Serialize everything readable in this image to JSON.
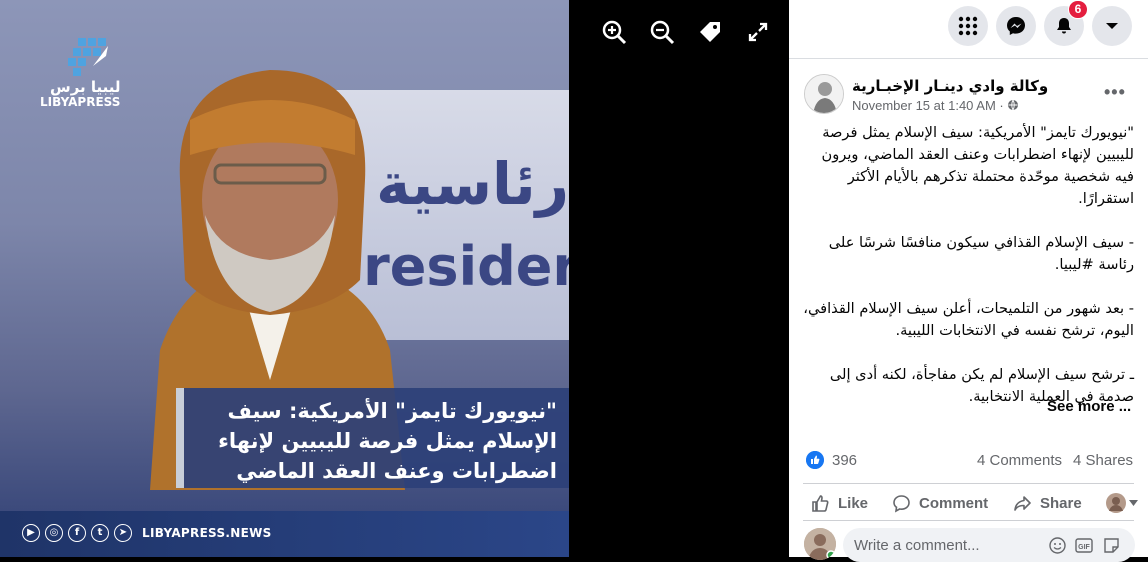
{
  "viewer": {
    "image": {
      "logo_ar": "ليبيا برس",
      "logo_en": "LIBYAPRESS",
      "banner_ar": "رئاسية",
      "banner_en": "Presider",
      "caption": "\"نيويورك تايمز\" الأمريكية: سيف الإسلام يمثل فرصة لليبيين لإنهاء اضطرابات وعنف العقد الماضي",
      "site": "LIBYAPRESS.NEWS",
      "socials": [
        "youtube-icon",
        "instagram-icon",
        "facebook-icon",
        "twitter-icon",
        "telegram-icon"
      ]
    },
    "tools": [
      "zoom-in-icon",
      "zoom-out-icon",
      "tag-icon",
      "fullscreen-icon"
    ]
  },
  "topbar": {
    "buttons": [
      "menu-grid-icon",
      "messenger-icon",
      "notifications-icon",
      "account-dropdown-icon"
    ],
    "notifications_badge": "6"
  },
  "post": {
    "page_name": "وكالة وادي دينـار الإخبـارية",
    "time": "November 15 at 1:40 AM ·",
    "paragraphs": [
      "\"نيويورك تايمز\" الأمريكية: سيف الإسلام يمثل فرصة لليبيين لإنهاء اضطرابات وعنف العقد الماضي، ويرون فيه شخصية موحّدة محتملة تذكرهم بالأيام الأكثر استقرارًا.",
      "- سيف الإسلام القذافي سيكون منافسًا شرسًا على رئاسة #ليبيا.",
      "- بعد شهور من التلميحات، أعلن سيف الإسلام القذافي، اليوم، ترشح نفسه في الانتخابات الليبية.",
      "ـ ترشح سيف الإسلام لم يكن مفاجأة، لكنه أدى إلى صدمة في العملية الانتخابية."
    ],
    "see_more": "See more ...",
    "likes": "396",
    "comments": "4 Comments",
    "shares": "4 Shares",
    "actions": {
      "like": "Like",
      "comment": "Comment",
      "share": "Share"
    },
    "comment_placeholder": "Write a comment..."
  }
}
